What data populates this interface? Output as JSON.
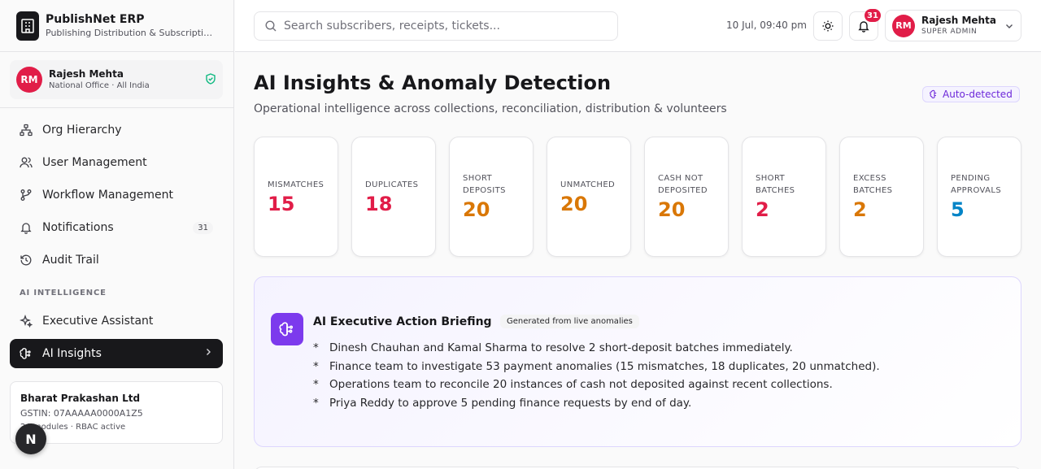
{
  "brand": {
    "title": "PublishNet ERP",
    "subtitle": "Publishing Distribution & Subscriptions"
  },
  "current_user": {
    "initials": "RM",
    "name": "Rajesh Mehta",
    "scope": "National Office · All India",
    "role": "SUPER ADMIN"
  },
  "sidebar": {
    "items": [
      {
        "label": "Org Hierarchy",
        "icon": "org-hierarchy-icon"
      },
      {
        "label": "User Management",
        "icon": "users-icon"
      },
      {
        "label": "Workflow Management",
        "icon": "git-branch-icon"
      },
      {
        "label": "Notifications",
        "icon": "bell-icon",
        "badge": "31"
      },
      {
        "label": "Audit Trail",
        "icon": "history-icon"
      }
    ],
    "section_label": "AI INTELLIGENCE",
    "ai_items": [
      {
        "label": "Executive Assistant",
        "icon": "sparkles-icon"
      },
      {
        "label": "AI Insights",
        "icon": "brain-icon",
        "active": true
      }
    ]
  },
  "company": {
    "name": "Bharat Prakashan Ltd",
    "gstin": "GSTIN: 07AAAAA0000A1Z5",
    "modules": "24 modules · RBAC active"
  },
  "fab_label": "N",
  "header": {
    "search_placeholder": "Search subscribers, receipts, tickets...",
    "datetime": "10 Jul, 09:40 pm",
    "notification_count": "31"
  },
  "page": {
    "title": "AI Insights & Anomaly Detection",
    "subtitle": "Operational intelligence across collections, reconciliation, distribution & volunteers",
    "chip": "Auto-detected"
  },
  "stats": [
    {
      "label": "MISMATCHES",
      "value": "15",
      "color": "#e11d48"
    },
    {
      "label": "DUPLICATES",
      "value": "18",
      "color": "#e11d48"
    },
    {
      "label": "SHORT DEPOSITS",
      "value": "20",
      "color": "#d97706"
    },
    {
      "label": "UNMATCHED",
      "value": "20",
      "color": "#d97706"
    },
    {
      "label": "CASH NOT DEPOSITED",
      "value": "20",
      "color": "#d97706"
    },
    {
      "label": "SHORT BATCHES",
      "value": "2",
      "color": "#e11d48"
    },
    {
      "label": "EXCESS BATCHES",
      "value": "2",
      "color": "#d97706"
    },
    {
      "label": "PENDING APPROVALS",
      "value": "5",
      "color": "#0284c7"
    }
  ],
  "briefing": {
    "title": "AI Executive Action Briefing",
    "chip": "Generated from live anomalies",
    "bullet": "*",
    "items": [
      "Dinesh Chauhan and Kamal Sharma to resolve 2 short-deposit batches immediately.",
      "Finance team to investigate 53 payment anomalies (15 mismatches, 18 duplicates, 20 unmatched).",
      "Operations team to reconcile 20 instances of cash not deposited against recent collections.",
      "Priya Reddy to approve 5 pending finance requests by end of day."
    ]
  },
  "colors": {
    "accent": "#7c3aed",
    "danger": "#e11d48",
    "warning": "#d97706",
    "info": "#0284c7",
    "dark": "#18181b"
  }
}
